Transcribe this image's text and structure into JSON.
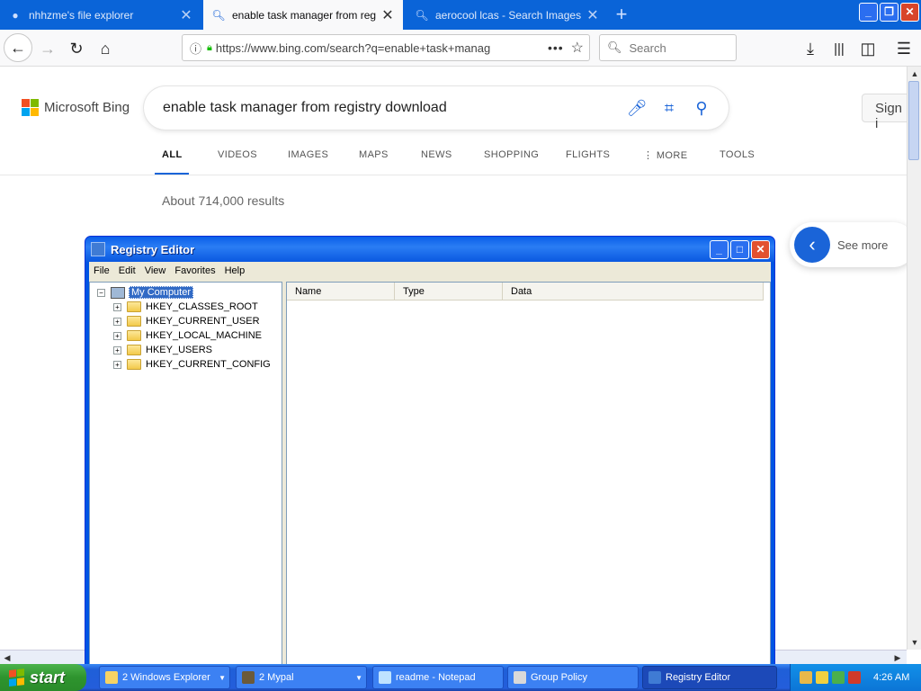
{
  "browser": {
    "tabs": [
      {
        "label": "nhhzme's file explorer",
        "icon": "globe-icon",
        "active": false
      },
      {
        "label": "enable task manager from registry",
        "icon": "search-icon",
        "active": true
      },
      {
        "label": "aerocool lcas - Search Images",
        "icon": "search-icon",
        "active": false
      }
    ],
    "url": "https://www.bing.com/search?q=enable+task+manag",
    "search_placeholder": "Search"
  },
  "bing": {
    "logo_text": "Microsoft Bing",
    "query": "enable task manager from registry download",
    "sign_in": "Sign i",
    "scopes": [
      "ALL",
      "VIDEOS",
      "IMAGES",
      "MAPS",
      "NEWS",
      "SHOPPING",
      "FLIGHTS",
      "MORE",
      "TOOLS"
    ],
    "results_count": "About 714,000 results",
    "see_more": "See more",
    "colors": {
      "red": "#f25022",
      "green": "#7fba00",
      "blue": "#00a4ef",
      "yellow": "#ffb900",
      "accent": "#1a64d8"
    }
  },
  "regedit": {
    "title": "Registry Editor",
    "menu": [
      "File",
      "Edit",
      "View",
      "Favorites",
      "Help"
    ],
    "root": "My Computer",
    "keys": [
      "HKEY_CLASSES_ROOT",
      "HKEY_CURRENT_USER",
      "HKEY_LOCAL_MACHINE",
      "HKEY_USERS",
      "HKEY_CURRENT_CONFIG"
    ],
    "columns": [
      "Name",
      "Type",
      "Data"
    ]
  },
  "taskbar": {
    "start": "start",
    "items": [
      {
        "label": "2 Windows Explorer",
        "active": false
      },
      {
        "label": "2 Mypal",
        "active": false
      },
      {
        "label": "readme - Notepad",
        "active": false
      },
      {
        "label": "Group Policy",
        "active": false
      },
      {
        "label": "Registry Editor",
        "active": true
      }
    ],
    "clock": "4:26 AM"
  }
}
